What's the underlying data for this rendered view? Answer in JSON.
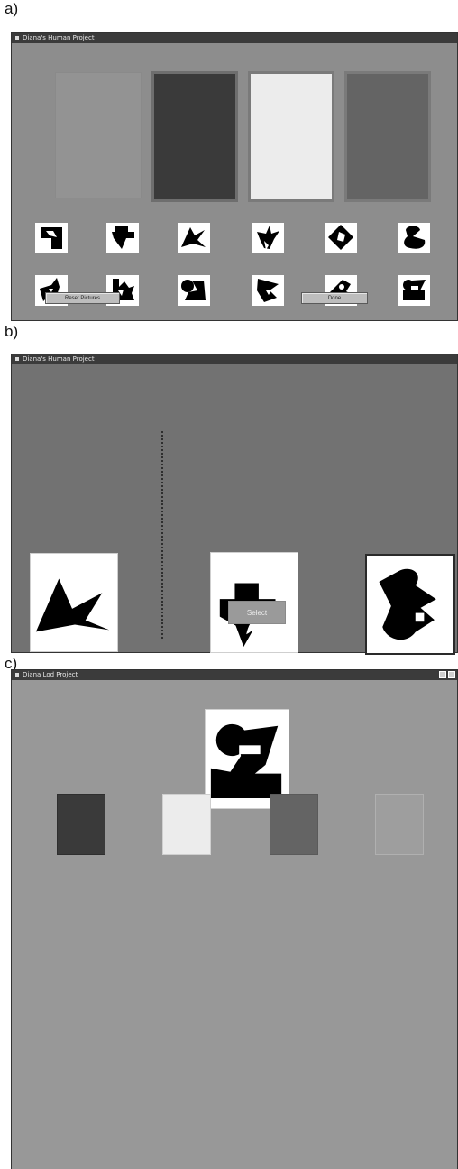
{
  "panels": [
    {
      "label": "a)",
      "title": "Diana's Human Project",
      "buttons": {
        "reset": "Reset Pictures",
        "done": "Done"
      }
    },
    {
      "label": "b)",
      "title": "Diana's Human Project",
      "buttons": {
        "select": "Select"
      }
    },
    {
      "label": "c)",
      "title": "Diana Lod Project"
    }
  ],
  "colors": {
    "panel_a_bg": "#8d8d8d",
    "panel_b_bg": "#727272",
    "panel_c_bg": "#989898",
    "card_dark": "#3a3a3a",
    "card_light": "#ececec",
    "card_mid": "#646464",
    "card_faint": "#9e9e9e"
  },
  "icons": [
    "shape-stimulus-icon",
    "window-menu-icon",
    "window-control-icon"
  ]
}
